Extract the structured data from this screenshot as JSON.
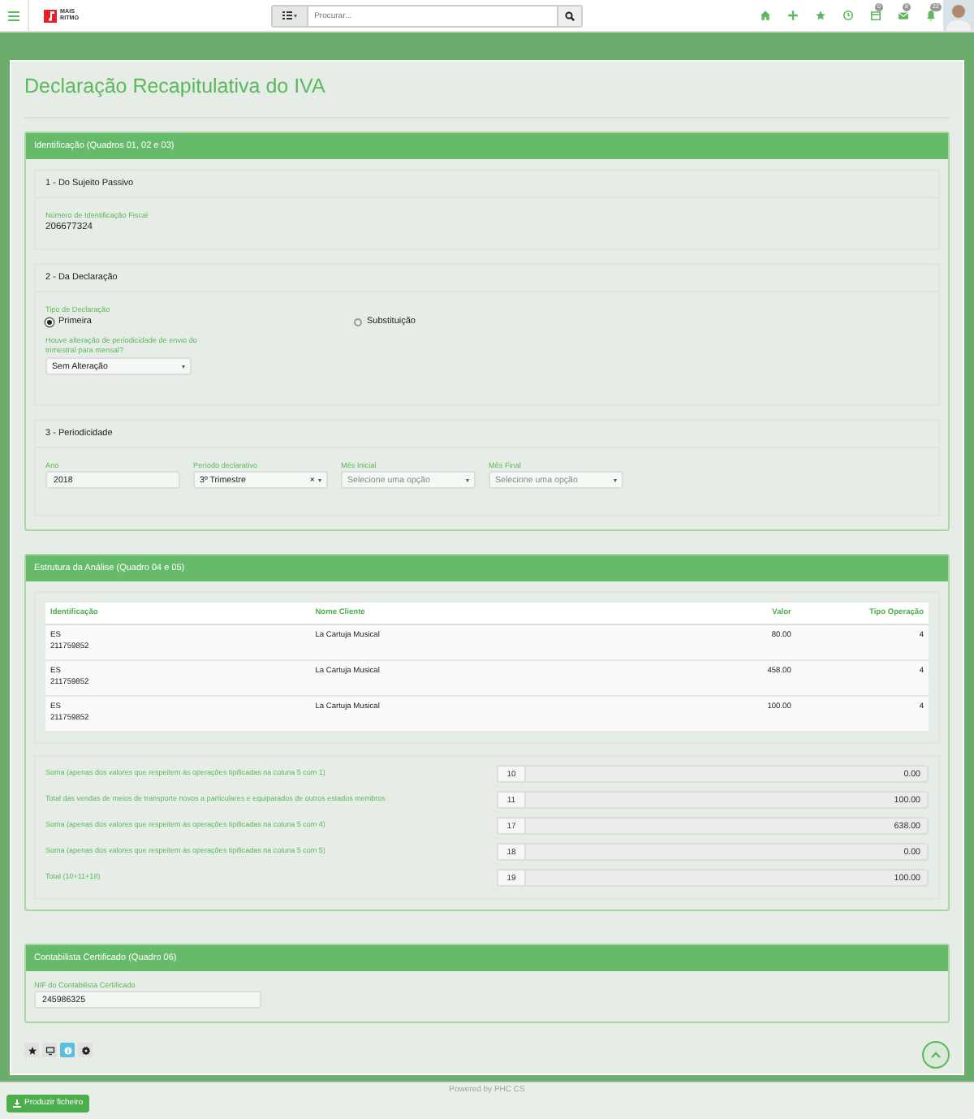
{
  "topbar": {
    "logo": {
      "line1": "MAIS",
      "line2": "RITMO"
    },
    "search": {
      "placeholder": "Procurar..."
    },
    "icons": [
      {
        "kind": "home"
      },
      {
        "kind": "plus"
      },
      {
        "kind": "star"
      },
      {
        "kind": "clock"
      },
      {
        "kind": "calendar",
        "badge": "0"
      },
      {
        "kind": "mail",
        "badge": "8"
      },
      {
        "kind": "bell",
        "badge": "22"
      }
    ]
  },
  "page_title": "Declaração Recapitulativa do IVA",
  "identification": {
    "title": "Identificação (Quadros 01, 02 e 03)",
    "taxpayer": {
      "title": "1 - Do Sujeito Passivo",
      "label": "Número de Identificação Fiscal",
      "value": "206677324"
    },
    "declaration": {
      "title": "2 - Da Declaração",
      "type_label": "Tipo de Declaração",
      "options": [
        {
          "label": "Primeira",
          "selected": true
        },
        {
          "label": "Substituição",
          "selected": false
        }
      ],
      "change_label": "Houve alteração de periodicidade de envio do trimestral para mensal?",
      "change_value": "Sem Alteração"
    },
    "periodicity": {
      "title": "3 - Periodicidade",
      "fields": [
        {
          "kind": "text",
          "label": "Ano",
          "value": "2018"
        },
        {
          "kind": "select",
          "label": "Período declarativo",
          "value": "3º Trimestre",
          "clear": "×"
        },
        {
          "kind": "select",
          "label": "Mês Inicial",
          "placeholder": "Selecione uma opção"
        },
        {
          "kind": "select",
          "label": "Mês Final",
          "placeholder": "Selecione uma opção"
        }
      ]
    }
  },
  "analysis": {
    "title": "Estrutura da Análise (Quadro 04 e 05)",
    "table": {
      "columns": [
        "Identificação",
        "Nome Cliente",
        "Valor",
        "Tipo Operação"
      ],
      "rows": [
        [
          "ES\n211759852",
          "La Cartuja Musical",
          "80.00",
          "4"
        ],
        [
          "ES\n211759852",
          "La Cartuja Musical",
          "458.00",
          "4"
        ],
        [
          "ES\n211759852",
          "La Cartuja Musical",
          "100.00",
          "4"
        ]
      ]
    },
    "totals": [
      {
        "label": "Soma (apenas dos valores que respeitem às operações tipificadas na coluna 5 com 1)",
        "code": "10",
        "value": "0.00"
      },
      {
        "label": "Total das vendas de meios de transporte novos a particulares e equiparados de outros estados membros",
        "code": "11",
        "value": "100.00"
      },
      {
        "label": "Soma (apenas dos valores que respeitem às operações tipificadas na coluna 5 com 4)",
        "code": "17",
        "value": "638.00"
      },
      {
        "label": "Soma (apenas dos valores que respeitem às operações tipificadas na coluna 5 com 5)",
        "code": "18",
        "value": "0.00"
      },
      {
        "label": "Total (10+11+18)",
        "code": "19",
        "value": "100.00"
      }
    ]
  },
  "accountant": {
    "title": "Contabilista Certificado (Quadro 06)",
    "label": "NIF do Contabilista Certificado",
    "value": "245986325"
  },
  "tools": [
    {
      "kind": "star",
      "selected": false
    },
    {
      "kind": "monitor",
      "selected": false
    },
    {
      "kind": "info",
      "selected": true
    },
    {
      "kind": "gear",
      "selected": false
    }
  ],
  "footer": {
    "button": "Produzir ficheiro",
    "powered": "Powered by PHC CS"
  }
}
